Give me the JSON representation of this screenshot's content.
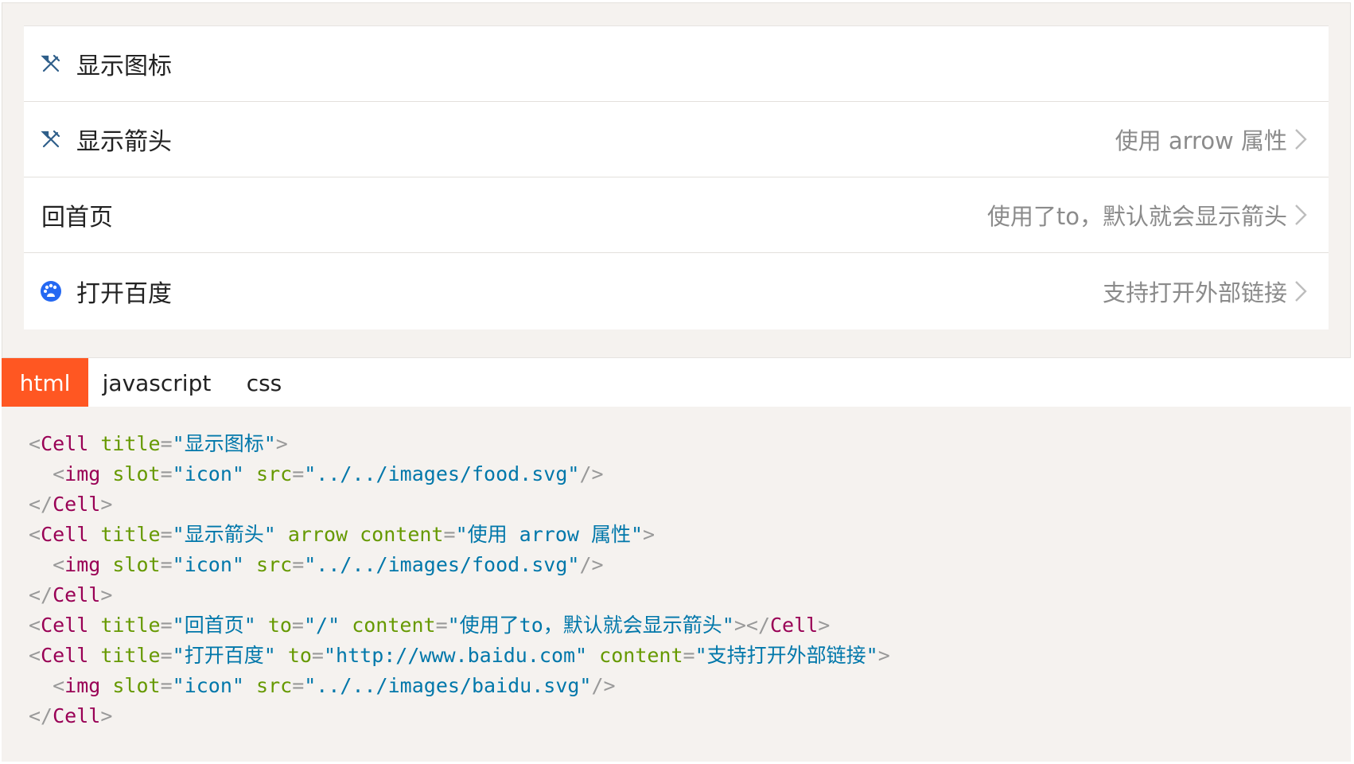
{
  "cells": [
    {
      "title": "显示图标",
      "icon": "food-icon",
      "content": "",
      "arrow": false
    },
    {
      "title": "显示箭头",
      "icon": "food-icon",
      "content": "使用 arrow 属性",
      "arrow": true
    },
    {
      "title": "回首页",
      "icon": "",
      "content": "使用了to，默认就会显示箭头",
      "arrow": true
    },
    {
      "title": "打开百度",
      "icon": "baidu-icon",
      "content": "支持打开外部链接",
      "arrow": true
    }
  ],
  "tabs": [
    {
      "label": "html",
      "active": true
    },
    {
      "label": "javascript",
      "active": false
    },
    {
      "label": "css",
      "active": false
    }
  ],
  "code": {
    "l1": {
      "t1": "<",
      "tag": "Cell",
      "attr": " title",
      "eq": "=",
      "val": "\"显示图标\"",
      "t2": ">"
    },
    "l2": {
      "indent": "  ",
      "t1": "<",
      "tag": "img",
      "a1": " slot",
      "e1": "=",
      "v1": "\"icon\"",
      "a2": " src",
      "e2": "=",
      "v2": "\"../../images/food.svg\"",
      "t2": "/>"
    },
    "l3": {
      "t1": "</",
      "tag": "Cell",
      "t2": ">"
    },
    "l4": {
      "t1": "<",
      "tag": "Cell",
      "a1": " title",
      "e1": "=",
      "v1": "\"显示箭头\"",
      "a2": " arrow",
      "a3": " content",
      "e3": "=",
      "v3": "\"使用 arrow 属性\"",
      "t2": ">"
    },
    "l5": {
      "indent": "  ",
      "t1": "<",
      "tag": "img",
      "a1": " slot",
      "e1": "=",
      "v1": "\"icon\"",
      "a2": " src",
      "e2": "=",
      "v2": "\"../../images/food.svg\"",
      "t2": "/>"
    },
    "l6": {
      "t1": "</",
      "tag": "Cell",
      "t2": ">"
    },
    "l7": {
      "t1": "<",
      "tag": "Cell",
      "a1": " title",
      "e1": "=",
      "v1": "\"回首页\"",
      "a2": " to",
      "e2": "=",
      "v2": "\"/\"",
      "a3": " content",
      "e3": "=",
      "v3": "\"使用了to，默认就会显示箭头\"",
      "t2": "></",
      "tag2": "Cell",
      "t3": ">"
    },
    "l8": {
      "t1": "<",
      "tag": "Cell",
      "a1": " title",
      "e1": "=",
      "v1": "\"打开百度\"",
      "a2": " to",
      "e2": "=",
      "v2": "\"http://www.baidu.com\"",
      "a3": " content",
      "e3": "=",
      "v3": "\"支持打开外部链接\"",
      "t2": ">"
    },
    "l9": {
      "indent": "  ",
      "t1": "<",
      "tag": "img",
      "a1": " slot",
      "e1": "=",
      "v1": "\"icon\"",
      "a2": " src",
      "e2": "=",
      "v2": "\"../../images/baidu.svg\"",
      "t2": "/>"
    },
    "l10": {
      "t1": "</",
      "tag": "Cell",
      "t2": ">"
    }
  },
  "colors": {
    "tab_active": "#ff5722",
    "food_icon": "#2f5f8a",
    "baidu_icon": "#2468f2",
    "code_tag": "#990055",
    "code_attr": "#669900",
    "code_string": "#0077aa"
  }
}
